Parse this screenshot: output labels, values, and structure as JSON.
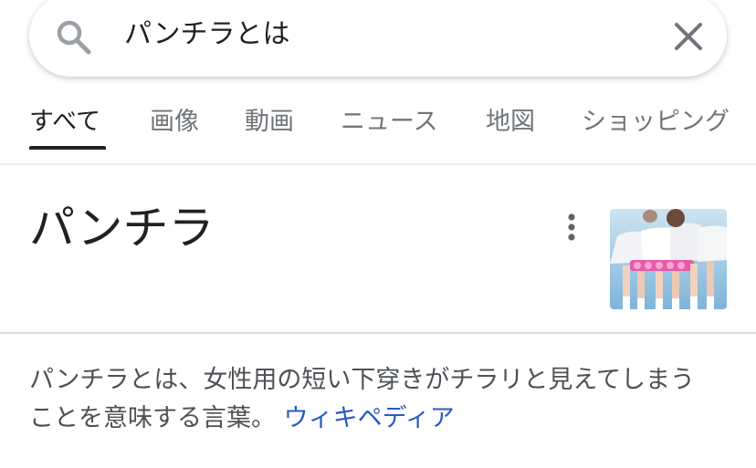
{
  "search": {
    "query": "パンチラとは",
    "search_icon": "search-icon",
    "clear_icon": "close-icon"
  },
  "tabs": [
    {
      "label": "すべて",
      "active": true
    },
    {
      "label": "画像",
      "active": false
    },
    {
      "label": "動画",
      "active": false
    },
    {
      "label": "ニュース",
      "active": false
    },
    {
      "label": "地図",
      "active": false
    },
    {
      "label": "ショッピング",
      "active": false
    }
  ],
  "knowledge_panel": {
    "title": "パンチラ",
    "more_icon": "more-vert-icon",
    "description_line1": "パンチラとは、女性用の短い下穿きがチラリと見えてしまう",
    "description_line2": "ことを意味する言葉。",
    "source_label": "ウィキペディア"
  },
  "colors": {
    "text_primary": "#202124",
    "text_secondary": "#70757a",
    "link": "#2b59c3",
    "divider": "#dadce0"
  }
}
